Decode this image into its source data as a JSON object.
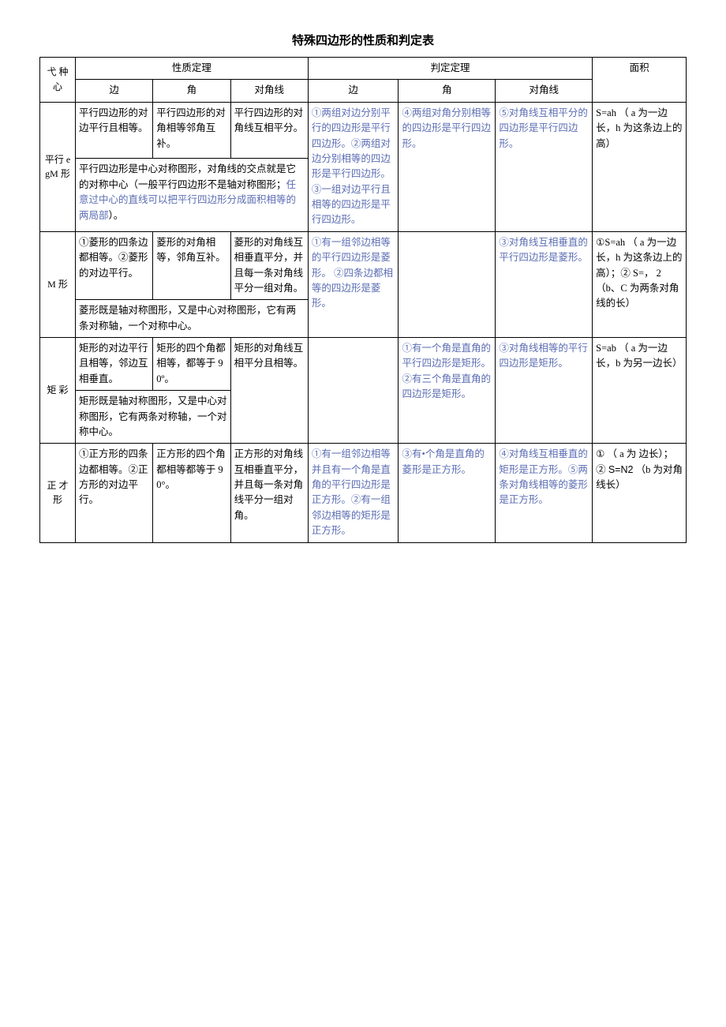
{
  "title": "特殊四边形的性质和判定表",
  "headers": {
    "rowhead": "弋\n种心",
    "group1": "性质定理",
    "group2": "判定定理",
    "area": "面积",
    "sub": {
      "bian1": "边",
      "jiao1": "角",
      "djx1": "对角线",
      "bian2": "边",
      "jiao2": "角",
      "djx2": "对角线"
    }
  },
  "rows": {
    "px": {
      "name": "平行 egM\n形",
      "p_bian": "平行四边形的对边平行且相等。",
      "p_jiao": "平行四边形的对角相等邻角互补。",
      "p_djx": "平行四边形的对角线互相平分。",
      "symm_a": "平行四边形是中心对称图形，对角线的交点就是它的对称中心（一般平行四边形不是轴对称图形；",
      "symm_b": "任意过中心的直线可以把平行四边形分成面积相等的两局部",
      "symm_c": "）。",
      "j_bian": "①两组对边分别平行的四边形是平行四边形。②两组对边分别相等的四边形是平行四边形。③一组对边平行且相等的四边形是平行四边形。",
      "j_jiao": "④两组对角分别相等的四边形是平行四边形。",
      "j_djx": "⑤对角线互相平分的四边形是平行四边形。",
      "area": "S=ah\n（ a 为一边长，h 为这条边上的高）"
    },
    "lx": {
      "name": "M\n\n\n\n形",
      "p_bian": "①菱形的四条边都相等。②菱形的对边平行。",
      "p_jiao": "菱形的对角相等，邻角互补。",
      "p_djx": "菱形的对角线互相垂直平分，并且每一条对角线平分一组对角。",
      "symm": "菱形既是轴对称图形，又是中心对称图形，它有两条对称轴，一个对称中心。",
      "j_bian": "①有一组邻边相等的平行四边形是菱形。\n\n②四条边都相等的四边形是菱形。",
      "j_jiao": "",
      "j_djx": "③对角线互相垂直的平行四边形是菱形。",
      "area": "①S=ah （ a 为一边长，h 为这条边上的高）；②\nS=， 2\n（b、C 为两条对角线的长）"
    },
    "jx": {
      "name": "矩\n\n彩",
      "p_bian": "矩形的对边平行且相等，邻边互相垂直。",
      "p_jiao": "矩形的四个角都相等，都等于 90º。",
      "p_djx": "矩形的对角线互相平分且相等。",
      "symm": "矩形既是轴对称图形，又是中心对称图形，它有两条对称轴，一个对称中心。",
      "j_bian": "",
      "j_jiao": "①有一个角是直角的平行四边形是矩形。\n②有三个角是直角的四边形是矩形。",
      "j_djx": "③对角线相等的平行四边形是矩形。",
      "area": "S=ab （ a 为一边长，b 为另一边长）"
    },
    "zf": {
      "name": "正\n才\n形",
      "p_bian": "①正方形的四条边都相等。②正方形的对边平行。",
      "p_jiao": "正方形的四个角都相等都等于 90°。",
      "p_djx": "正方形的对角线互相垂直平分，并且每一条对角线平分一组对角。",
      "j_bian": "①有一组邻边相等并且有一个角是直角的平行四边形是正方形。②有一组邻边相等的矩形是正方形。",
      "j_jiao": "③有•个角是直角的菱形是正方形。",
      "j_djx": "④对角线互相垂直的矩形是正方形。⑤两条对角线相等的菱形是正方形。",
      "area_a": "①\n（ a  为 边长）；\n②\n",
      "area_b": "S=N2",
      "area_c": "\n（b 为对角线长）"
    }
  }
}
